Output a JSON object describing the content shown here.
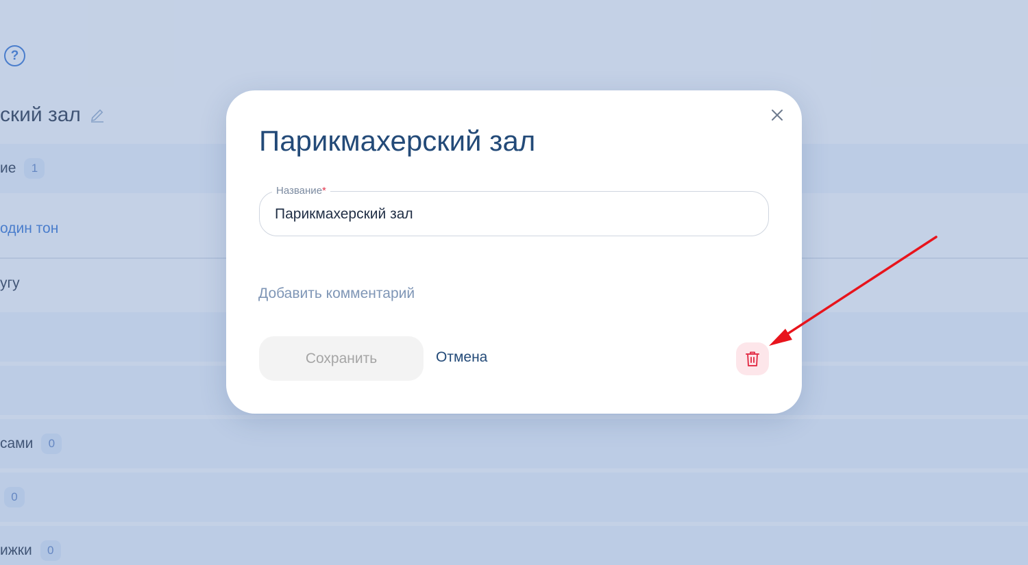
{
  "background": {
    "help_glyph": "?",
    "title_fragment": "ский зал",
    "rows": [
      {
        "text": "ие",
        "count": "1"
      },
      {
        "text": "один тон"
      },
      {
        "text": "угу"
      },
      {
        "text": "сами",
        "count": "0"
      },
      {
        "count": "0"
      },
      {
        "text": "ижки",
        "count": "0"
      }
    ]
  },
  "modal": {
    "title": "Парикмахерский зал",
    "name_field": {
      "label": "Название",
      "required_mark": "*",
      "value": "Парикмахерский зал"
    },
    "add_comment_label": "Добавить комментарий",
    "save_label": "Сохранить",
    "cancel_label": "Отмена",
    "icons": {
      "close": "close-icon",
      "delete": "trash-icon"
    }
  },
  "colors": {
    "accent_text": "#234a78",
    "danger": "#e3344c",
    "danger_bg": "#fde6ea",
    "annotation_arrow": "#e8141c"
  }
}
